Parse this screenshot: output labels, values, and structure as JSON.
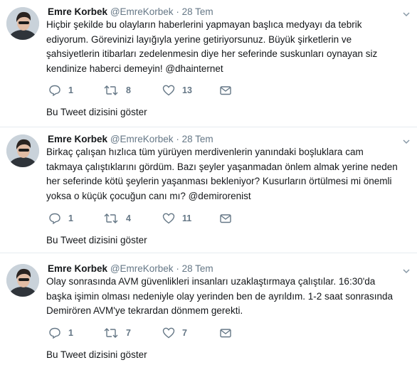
{
  "tweets": [
    {
      "name": "Emre Korbek",
      "handle": "@EmreKorbek",
      "dot": "·",
      "time": "28 Tem",
      "lines": [
        "Hiçbir şekilde bu olayların haberlerini yapmayan başlıca medyayı da tebrik",
        "ediyorum. Görevinizi layığıyla yerine getiriyorsunuz. Büyük şirketlerin ve",
        "şahsiyetlerin itibarları zedelenmesin diye her seferinde suskunları oynayan siz",
        "kendinize haberci demeyin! @dhainternet"
      ],
      "replies": "1",
      "retweets": "8",
      "likes": "13",
      "thread_link": "Bu Tweet dizisini göster"
    },
    {
      "name": "Emre Korbek",
      "handle": "@EmreKorbek",
      "dot": "·",
      "time": "28 Tem",
      "lines": [
        "Birkaç çalışan hızlıca tüm yürüyen merdivenlerin yanındaki boşluklara cam",
        "takmaya çalıştıklarını gördüm. Bazı şeyler yaşanmadan önlem almak yerine neden",
        "her seferinde kötü şeylerin yaşanması bekleniyor? Kusurların örtülmesi mi önemli",
        "yoksa o küçük çocuğun canı mı? @demirorenist"
      ],
      "replies": "1",
      "retweets": "4",
      "likes": "11",
      "thread_link": "Bu Tweet dizisini göster"
    },
    {
      "name": "Emre Korbek",
      "handle": "@EmreKorbek",
      "dot": "·",
      "time": "28 Tem",
      "lines": [
        "Olay sonrasında AVM güvenlikleri insanları uzaklaştırmaya çalıştılar. 16:30'da",
        "başka işimin olması nedeniyle olay yerinden ben de ayrıldım. 1-2 saat sonrasında",
        "Demirören AVM'ye tekrardan dönmem gerekti."
      ],
      "replies": "1",
      "retweets": "7",
      "likes": "7",
      "thread_link": "Bu Tweet dizisini göster"
    }
  ],
  "icons": {
    "reply": "reply-icon",
    "retweet": "retweet-icon",
    "like": "heart-icon",
    "message": "envelope-icon",
    "caret": "chevron-down-icon"
  },
  "colors": {
    "text": "#14171a",
    "muted": "#657786",
    "divider": "#e6ecf0"
  }
}
